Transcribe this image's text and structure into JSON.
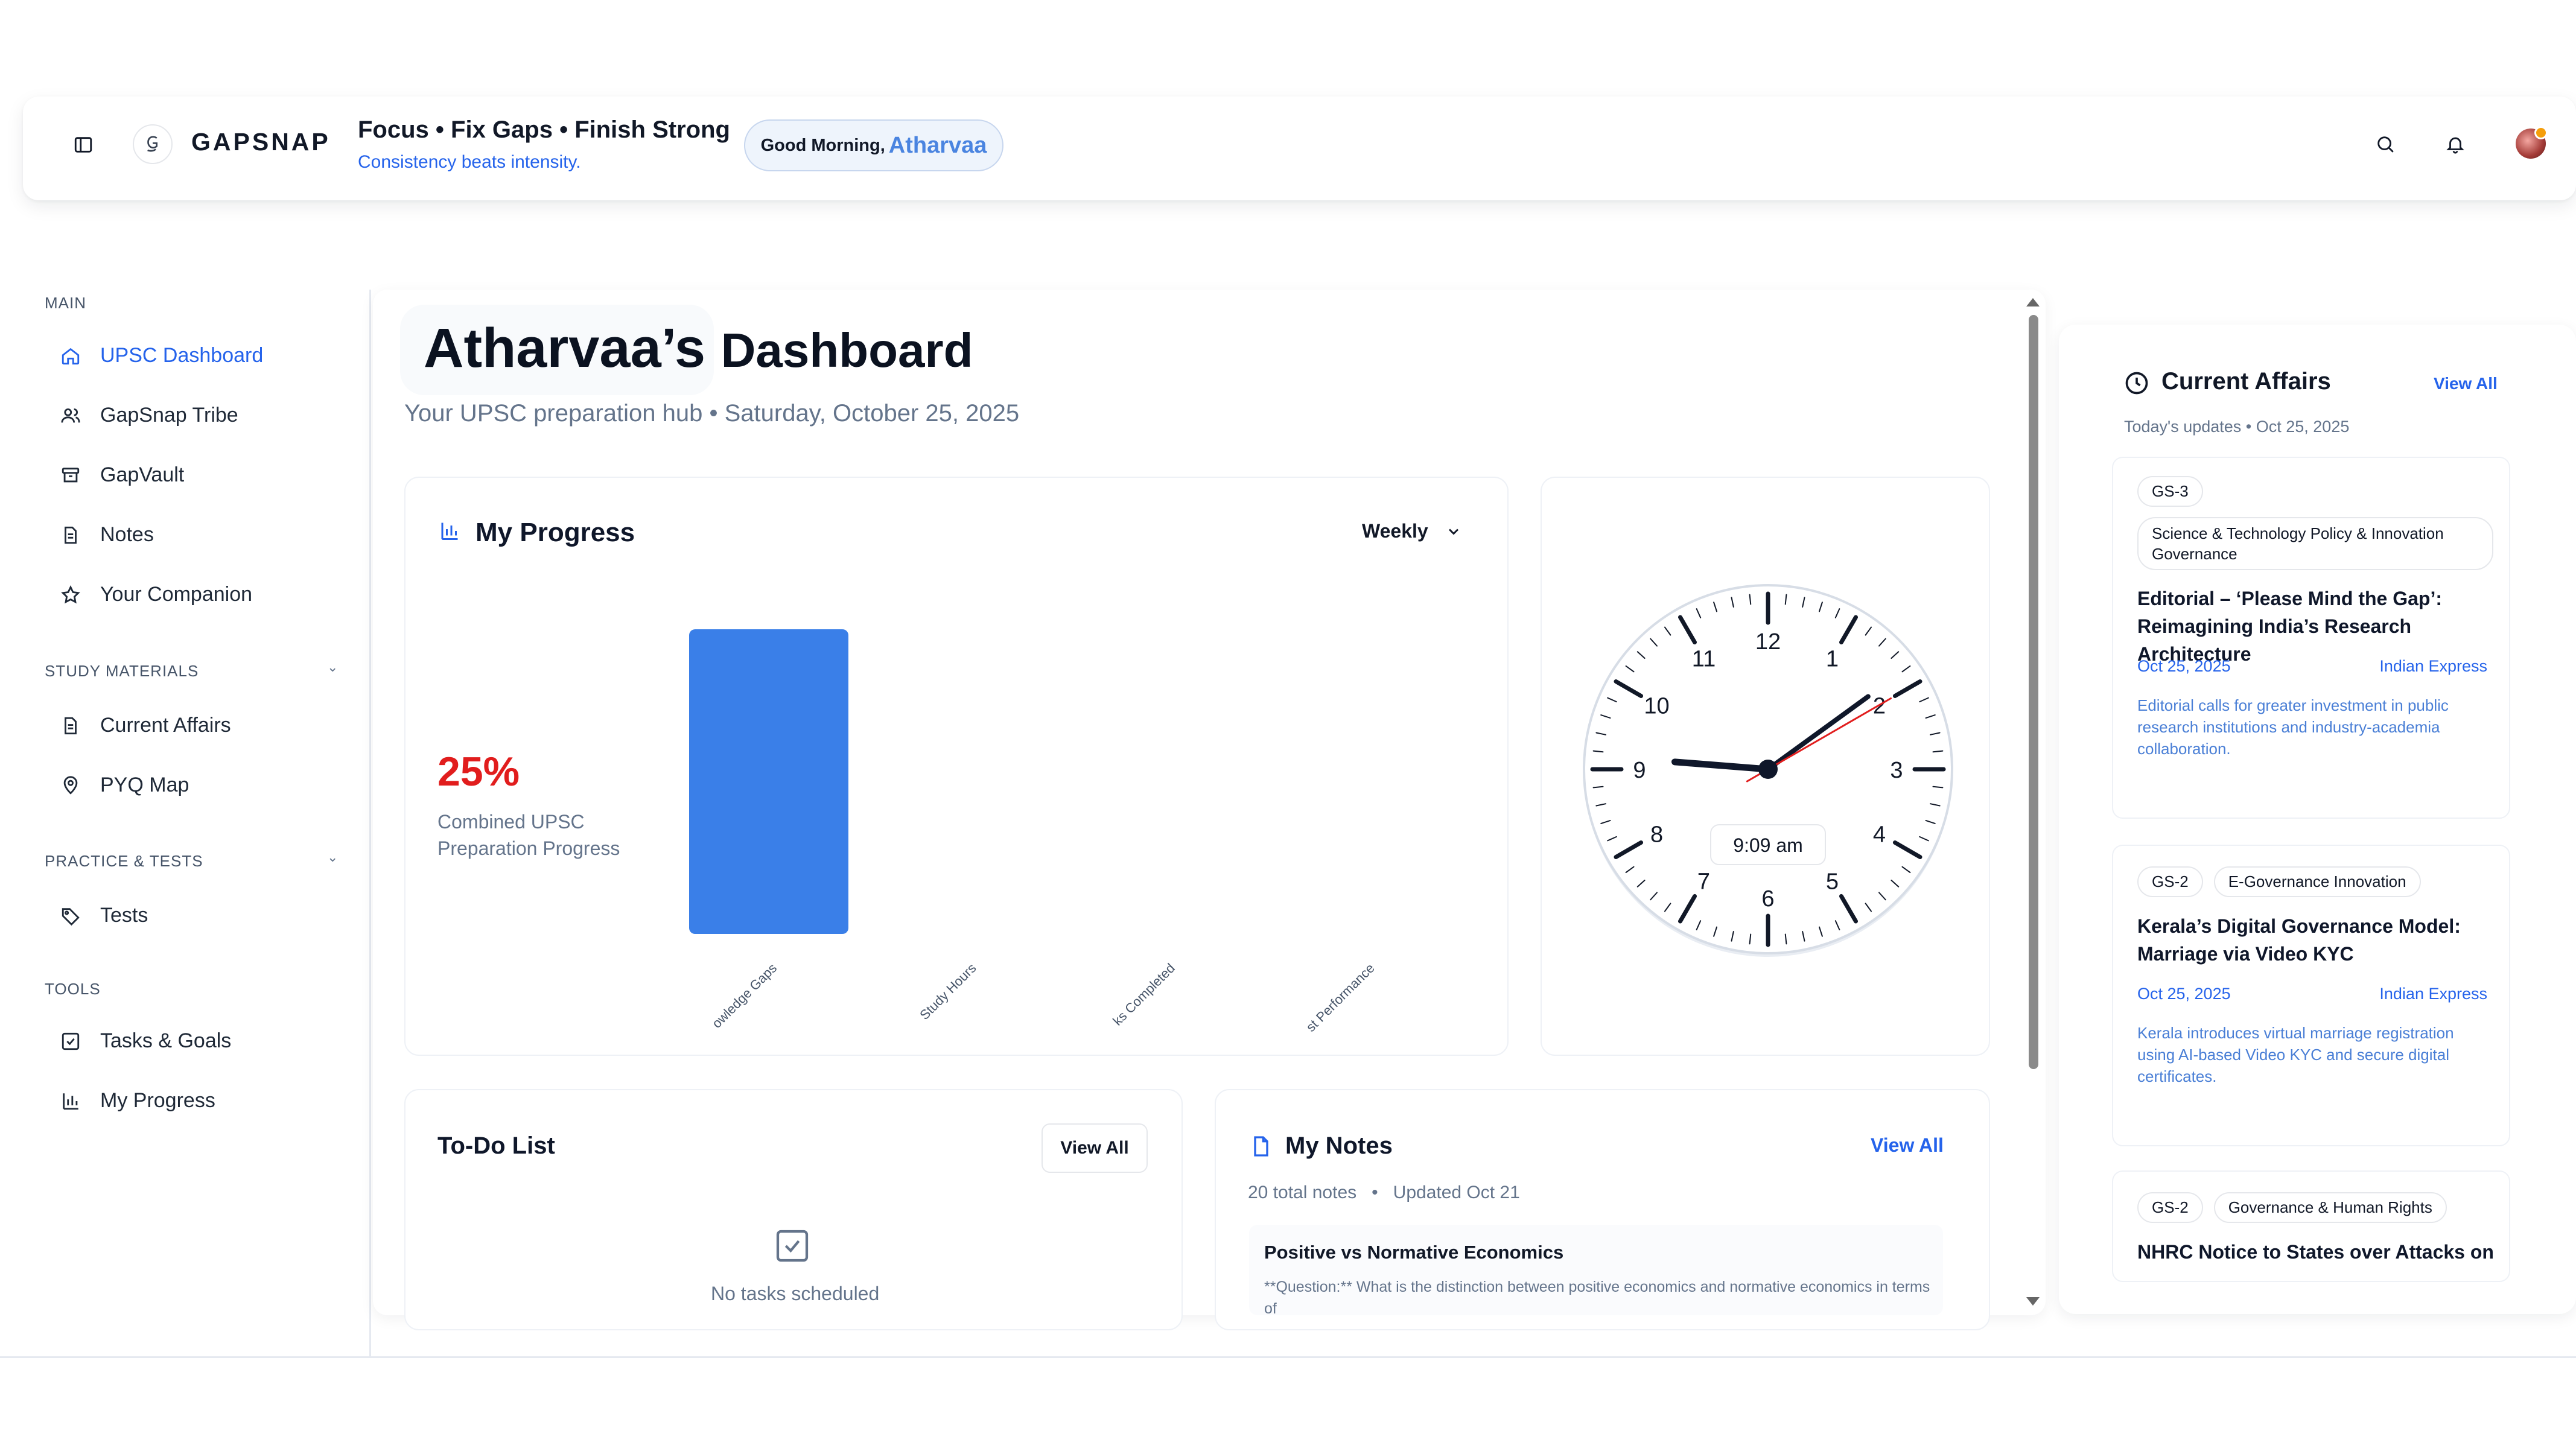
{
  "header": {
    "brand": "GAPSNAP",
    "tagline": "Focus • Fix Gaps • Finish Strong",
    "subtagline": "Consistency beats intensity.",
    "greeting_prefix": "Good Morning,",
    "greeting_name": "Atharvaa"
  },
  "sidebar": {
    "sections": [
      {
        "label": "MAIN"
      },
      {
        "label": "STUDY MATERIALS"
      },
      {
        "label": "PRACTICE & TESTS"
      },
      {
        "label": "TOOLS"
      }
    ],
    "items": [
      {
        "label": "UPSC Dashboard",
        "icon": "home-icon",
        "active": true
      },
      {
        "label": "GapSnap Tribe",
        "icon": "users-icon"
      },
      {
        "label": "GapVault",
        "icon": "archive-icon"
      },
      {
        "label": "Notes",
        "icon": "document-icon"
      },
      {
        "label": "Your Companion",
        "icon": "star-icon"
      },
      {
        "label": "Current Affairs",
        "icon": "document-icon"
      },
      {
        "label": "PYQ Map",
        "icon": "map-pin-icon"
      },
      {
        "label": "Tests",
        "icon": "tag-icon"
      },
      {
        "label": "Tasks & Goals",
        "icon": "checkbox-icon"
      },
      {
        "label": "My Progress",
        "icon": "bar-chart-icon"
      }
    ]
  },
  "main": {
    "title_name": "Atharvaa’s",
    "title_word": "Dashboard",
    "subtitle": "Your UPSC preparation hub • Saturday, October 25, 2025",
    "progress": {
      "title": "My Progress",
      "period": "Weekly",
      "percent": "25%",
      "percent_label": "Combined UPSC Preparation Progress"
    },
    "clock": {
      "time_text": "9:09 am",
      "numerals": [
        "12",
        "1",
        "2",
        "3",
        "4",
        "5",
        "6",
        "7",
        "8",
        "9",
        "10",
        "11"
      ]
    },
    "todo": {
      "title": "To-Do List",
      "view_all": "View All",
      "empty": "No tasks scheduled"
    },
    "notes": {
      "title": "My Notes",
      "view_all": "View All",
      "count": "20 total notes",
      "updated": "Updated Oct 21",
      "item_title": "Positive vs Normative Economics",
      "item_body": "**Question:** What is the distinction between positive economics and normative economics in terms of"
    }
  },
  "chart_data": {
    "type": "bar",
    "categories": [
      "Knowledge Gaps",
      "Study Hours",
      "Tasks Completed",
      "Test Performance"
    ],
    "visible_tick_labels": [
      "owledge Gaps",
      "Study Hours",
      "ks Completed",
      "st Performance"
    ],
    "values": [
      100,
      0,
      0,
      0
    ],
    "ylim": [
      0,
      100
    ],
    "color": "#3a7fe8"
  },
  "current_affairs": {
    "title": "Current Affairs",
    "view_all": "View All",
    "subtitle": "Today's updates • Oct 25, 2025",
    "items": [
      {
        "tags": [
          "GS-3",
          "Science & Technology Policy & Innovation Governance"
        ],
        "title": "Editorial – ‘Please Mind the Gap’: Reimagining India’s Research Architecture",
        "date": "Oct 25, 2025",
        "source": "Indian Express",
        "desc": "Editorial calls for greater investment in public research institutions and industry-academia collaboration."
      },
      {
        "tags": [
          "GS-2",
          "E-Governance Innovation"
        ],
        "title": "Kerala’s Digital Governance Model: Marriage via Video KYC",
        "date": "Oct 25, 2025",
        "source": "Indian Express",
        "desc": "Kerala introduces virtual marriage registration using AI-based Video KYC and secure digital certificates."
      },
      {
        "tags": [
          "GS-2",
          "Governance & Human Rights"
        ],
        "title": "NHRC Notice to States over Attacks on"
      }
    ]
  },
  "colors": {
    "accent": "#2563eb",
    "bar": "#3a7fe8",
    "percent": "#e11d1d",
    "clock_second_hand": "#e11d1d"
  }
}
